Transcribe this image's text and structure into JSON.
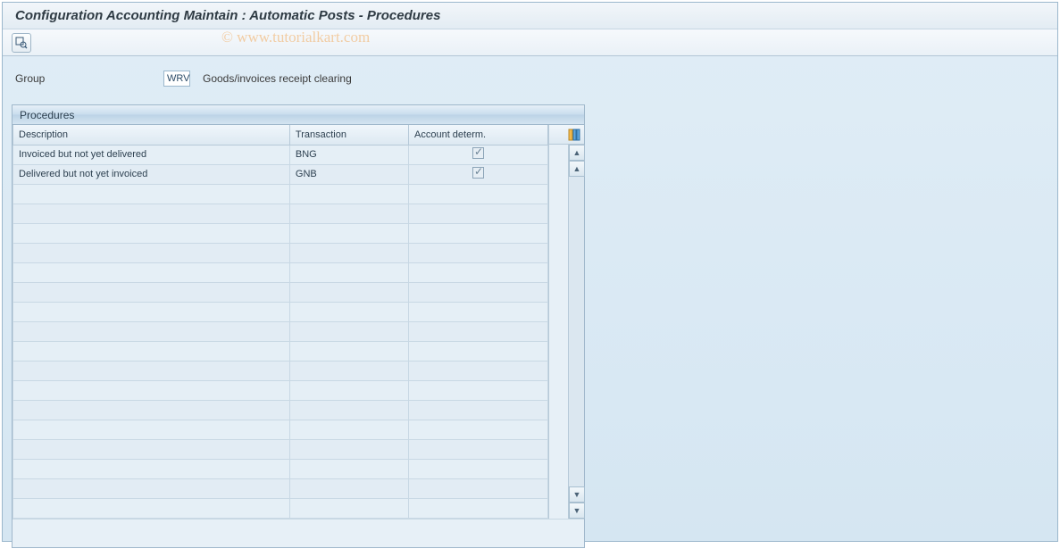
{
  "title": "Configuration Accounting Maintain : Automatic Posts - Procedures",
  "watermark": "© www.tutorialkart.com",
  "group": {
    "label": "Group",
    "code": "WRV",
    "description": "Goods/invoices receipt clearing"
  },
  "panel": {
    "title": "Procedures",
    "columns": {
      "description": "Description",
      "transaction": "Transaction",
      "account_determ": "Account determ."
    },
    "rows": [
      {
        "description": "Invoiced but not yet delivered",
        "transaction": "BNG",
        "account_determ": true,
        "is_link": true
      },
      {
        "description": "Delivered but not yet invoiced",
        "transaction": "GNB",
        "account_determ": true,
        "is_link": false
      }
    ]
  }
}
